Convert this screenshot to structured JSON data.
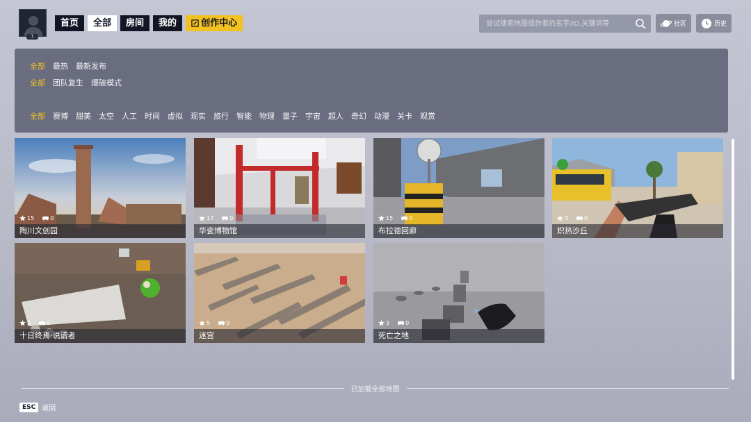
{
  "header": {
    "avatar_level": "1",
    "nav": [
      {
        "label": "首页",
        "active": false
      },
      {
        "label": "全部",
        "active": true
      },
      {
        "label": "房间",
        "active": false
      },
      {
        "label": "我的",
        "active": false
      }
    ],
    "create_label": "创作中心",
    "search_placeholder": "尝试搜索地图或作者的名字/ID,关键词等",
    "community_label": "社区",
    "history_label": "历史"
  },
  "filters": {
    "row1": [
      "全部",
      "最热",
      "最新发布"
    ],
    "row2": [
      "全部",
      "团队复生",
      "爆破模式"
    ],
    "row3": [
      "全部",
      "赛博",
      "甜美",
      "太空",
      "人工",
      "时间",
      "虚拟",
      "现实",
      "旅行",
      "智能",
      "物理",
      "量子",
      "宇宙",
      "超人",
      "奇幻",
      "动漫",
      "关卡",
      "观赏"
    ]
  },
  "maps": [
    {
      "title": "陶川文创园",
      "likes": "15",
      "plays": "0"
    },
    {
      "title": "华瓷博物馆",
      "likes": "17",
      "plays": "0"
    },
    {
      "title": "布拉德回廊",
      "likes": "15",
      "plays": "0"
    },
    {
      "title": "炽热沙丘",
      "likes": "3",
      "plays": "0"
    },
    {
      "title": "十日终焉·说谎者",
      "likes": "3",
      "plays": "0"
    },
    {
      "title": "迷宫",
      "likes": "5",
      "plays": "0"
    },
    {
      "title": "死亡之地",
      "likes": "3",
      "plays": "0"
    }
  ],
  "footer": {
    "loaded_text": "已加载全部地图",
    "esc_key": "ESC",
    "esc_label": "返回"
  },
  "colors": {
    "accent": "#f3c21f",
    "nav_bg": "#121624",
    "panel_bg": "#6a6d80"
  }
}
